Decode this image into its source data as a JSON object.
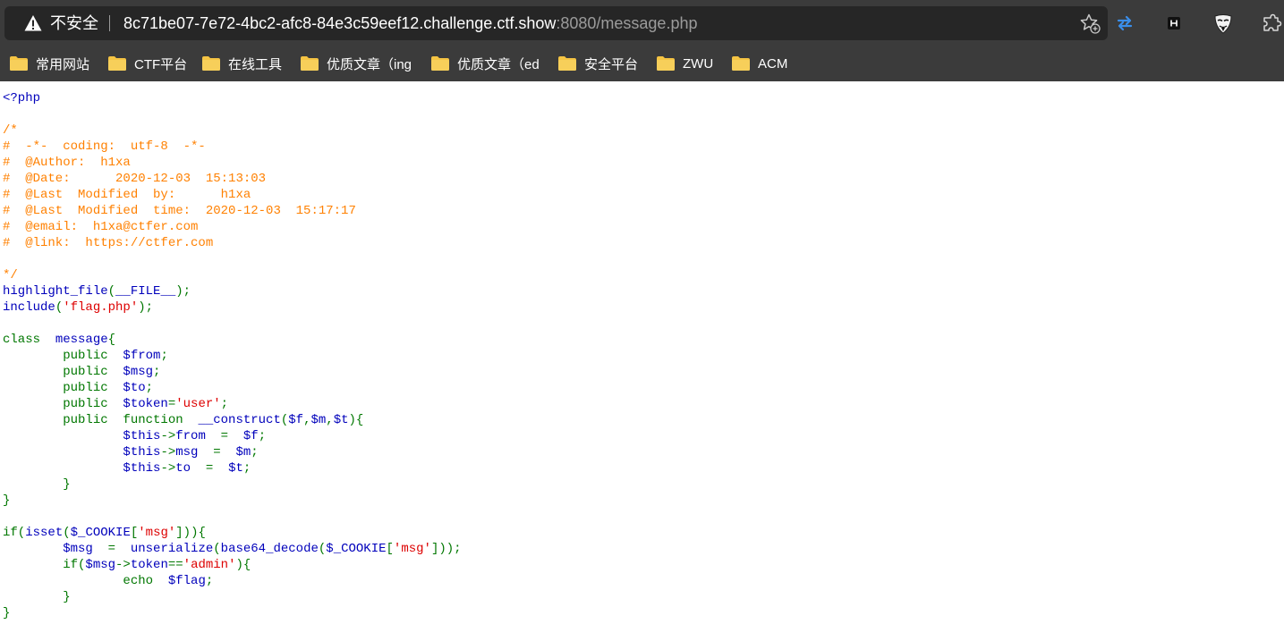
{
  "browser": {
    "security_label": "不安全",
    "url_host": "8c71be07-7e72-4bc2-afc8-84e3c59eef12.challenge.ctf.show",
    "url_rest": ":8080/message.php"
  },
  "bookmarks": [
    {
      "label": "常用网站"
    },
    {
      "label": "CTF平台"
    },
    {
      "label": "在线工具"
    },
    {
      "label": "优质文章（ing"
    },
    {
      "label": "优质文章（ed"
    },
    {
      "label": "安全平台"
    },
    {
      "label": "ZWU"
    },
    {
      "label": "ACM"
    }
  ],
  "colors": {
    "keyword": "#007700",
    "default": "#0000bb",
    "string": "#dd0000",
    "comment": "#ff8000",
    "toolbar": "#3b3b3b",
    "folder": "#f5c443"
  },
  "code_lines": [
    [
      [
        "def",
        "<?php"
      ]
    ],
    [],
    [
      [
        "com",
        "/*"
      ]
    ],
    [
      [
        "com",
        "#  -*-  coding:  utf-8  -*-"
      ]
    ],
    [
      [
        "com",
        "#  @Author:  h1xa"
      ]
    ],
    [
      [
        "com",
        "#  @Date:      2020-12-03  15:13:03"
      ]
    ],
    [
      [
        "com",
        "#  @Last  Modified  by:      h1xa"
      ]
    ],
    [
      [
        "com",
        "#  @Last  Modified  time:  2020-12-03  15:17:17"
      ]
    ],
    [
      [
        "com",
        "#  @email:  h1xa@ctfer.com"
      ]
    ],
    [
      [
        "com",
        "#  @link:  https://ctfer.com"
      ]
    ],
    [],
    [
      [
        "com",
        "*/"
      ]
    ],
    [
      [
        "def",
        "highlight_file"
      ],
      [
        "kw",
        "("
      ],
      [
        "def",
        "__FILE__"
      ],
      [
        "kw",
        ");"
      ]
    ],
    [
      [
        "def",
        "include"
      ],
      [
        "kw",
        "("
      ],
      [
        "str",
        "'flag.php'"
      ],
      [
        "kw",
        ");"
      ]
    ],
    [],
    [
      [
        "kw",
        "class  "
      ],
      [
        "def",
        "message"
      ],
      [
        "kw",
        "{"
      ]
    ],
    [
      [
        "kw",
        "        public  "
      ],
      [
        "def",
        "$from"
      ],
      [
        "kw",
        ";"
      ]
    ],
    [
      [
        "kw",
        "        public  "
      ],
      [
        "def",
        "$msg"
      ],
      [
        "kw",
        ";"
      ]
    ],
    [
      [
        "kw",
        "        public  "
      ],
      [
        "def",
        "$to"
      ],
      [
        "kw",
        ";"
      ]
    ],
    [
      [
        "kw",
        "        public  "
      ],
      [
        "def",
        "$token"
      ],
      [
        "kw",
        "="
      ],
      [
        "str",
        "'user'"
      ],
      [
        "kw",
        ";"
      ]
    ],
    [
      [
        "kw",
        "        public  function  "
      ],
      [
        "def",
        "__construct"
      ],
      [
        "kw",
        "("
      ],
      [
        "def",
        "$f"
      ],
      [
        "kw",
        ","
      ],
      [
        "def",
        "$m"
      ],
      [
        "kw",
        ","
      ],
      [
        "def",
        "$t"
      ],
      [
        "kw",
        "){"
      ]
    ],
    [
      [
        "def",
        "                $this"
      ],
      [
        "kw",
        "->"
      ],
      [
        "def",
        "from  "
      ],
      [
        "kw",
        "=  "
      ],
      [
        "def",
        "$f"
      ],
      [
        "kw",
        ";"
      ]
    ],
    [
      [
        "def",
        "                $this"
      ],
      [
        "kw",
        "->"
      ],
      [
        "def",
        "msg  "
      ],
      [
        "kw",
        "=  "
      ],
      [
        "def",
        "$m"
      ],
      [
        "kw",
        ";"
      ]
    ],
    [
      [
        "def",
        "                $this"
      ],
      [
        "kw",
        "->"
      ],
      [
        "def",
        "to  "
      ],
      [
        "kw",
        "=  "
      ],
      [
        "def",
        "$t"
      ],
      [
        "kw",
        ";"
      ]
    ],
    [
      [
        "kw",
        "        }"
      ]
    ],
    [
      [
        "kw",
        "}"
      ]
    ],
    [],
    [
      [
        "kw",
        "if("
      ],
      [
        "def",
        "isset"
      ],
      [
        "kw",
        "("
      ],
      [
        "def",
        "$_COOKIE"
      ],
      [
        "kw",
        "["
      ],
      [
        "str",
        "'msg'"
      ],
      [
        "kw",
        "])){"
      ]
    ],
    [
      [
        "def",
        "        $msg  "
      ],
      [
        "kw",
        "=  "
      ],
      [
        "def",
        "unserialize"
      ],
      [
        "kw",
        "("
      ],
      [
        "def",
        "base64_decode"
      ],
      [
        "kw",
        "("
      ],
      [
        "def",
        "$_COOKIE"
      ],
      [
        "kw",
        "["
      ],
      [
        "str",
        "'msg'"
      ],
      [
        "kw",
        "]));"
      ]
    ],
    [
      [
        "kw",
        "        if("
      ],
      [
        "def",
        "$msg"
      ],
      [
        "kw",
        "->"
      ],
      [
        "def",
        "token"
      ],
      [
        "kw",
        "=="
      ],
      [
        "str",
        "'admin'"
      ],
      [
        "kw",
        "){"
      ]
    ],
    [
      [
        "kw",
        "                echo  "
      ],
      [
        "def",
        "$flag"
      ],
      [
        "kw",
        ";"
      ]
    ],
    [
      [
        "kw",
        "        }"
      ]
    ],
    [
      [
        "kw",
        "}"
      ]
    ]
  ]
}
